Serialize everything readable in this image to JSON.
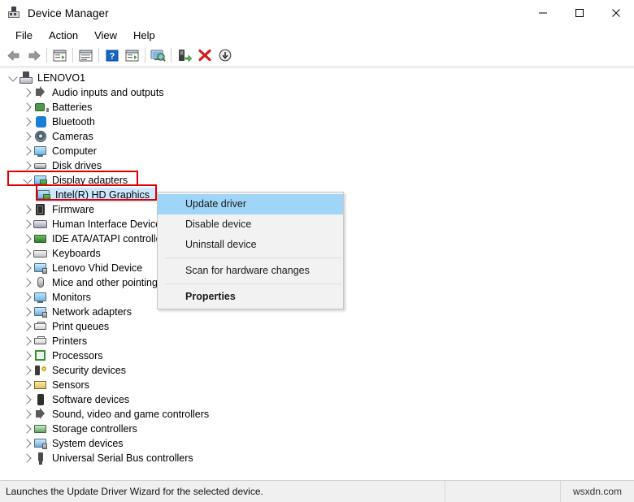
{
  "window": {
    "title": "Device Manager",
    "icon": "device-manager-icon",
    "controls": {
      "minimize": "–",
      "maximize": "□",
      "close": "✕"
    }
  },
  "menubar": {
    "items": [
      {
        "label": "File"
      },
      {
        "label": "Action"
      },
      {
        "label": "View"
      },
      {
        "label": "Help"
      }
    ]
  },
  "toolbar": {
    "buttons": [
      {
        "name": "back-arrow-icon",
        "title": "Back"
      },
      {
        "name": "forward-arrow-icon",
        "title": "Forward"
      },
      {
        "name": "show-hide-console-tree-icon",
        "title": "Show/Hide Console Tree"
      },
      {
        "name": "properties-icon",
        "title": "Properties"
      },
      {
        "name": "help-icon",
        "title": "Help"
      },
      {
        "name": "show-hide-action-pane-icon",
        "title": "Show/Hide Action Pane"
      },
      {
        "name": "scan-hardware-changes-icon",
        "title": "Scan for hardware changes"
      },
      {
        "name": "update-driver-icon",
        "title": "Update Driver Software"
      },
      {
        "name": "uninstall-device-icon",
        "title": "Uninstall device"
      },
      {
        "name": "disable-device-icon",
        "title": "Disable device"
      }
    ]
  },
  "tree": {
    "root": {
      "label": "LENOVO1",
      "icon": "computer-root-icon",
      "expanded": true
    },
    "items": [
      {
        "label": "Audio inputs and outputs",
        "icon": "speaker-icon",
        "expanded": false,
        "level": 2
      },
      {
        "label": "Batteries",
        "icon": "battery-icon",
        "expanded": false,
        "level": 2
      },
      {
        "label": "Bluetooth",
        "icon": "bluetooth-icon",
        "expanded": false,
        "level": 2
      },
      {
        "label": "Cameras",
        "icon": "camera-icon",
        "expanded": false,
        "level": 2
      },
      {
        "label": "Computer",
        "icon": "computer-icon",
        "expanded": false,
        "level": 2
      },
      {
        "label": "Disk drives",
        "icon": "disk-drive-icon",
        "expanded": false,
        "level": 2
      },
      {
        "label": "Display adapters",
        "icon": "display-adapter-icon",
        "expanded": true,
        "level": 2,
        "highlighted": true
      },
      {
        "label": "Intel(R) HD Graphics",
        "icon": "display-adapter-icon",
        "level": 3,
        "selected": true,
        "highlighted": true
      },
      {
        "label": "Firmware",
        "icon": "firmware-icon",
        "expanded": false,
        "level": 2
      },
      {
        "label": "Human Interface Devices",
        "icon": "human-interface-icon",
        "expanded": false,
        "level": 2
      },
      {
        "label": "IDE ATA/ATAPI controllers",
        "icon": "ide-controller-icon",
        "expanded": false,
        "level": 2
      },
      {
        "label": "Keyboards",
        "icon": "keyboard-icon",
        "expanded": false,
        "level": 2
      },
      {
        "label": "Lenovo Vhid Device",
        "icon": "monitor-icon",
        "expanded": false,
        "level": 2
      },
      {
        "label": "Mice and other pointing devices",
        "icon": "mouse-icon",
        "expanded": false,
        "level": 2
      },
      {
        "label": "Monitors",
        "icon": "monitor-icon",
        "expanded": false,
        "level": 2
      },
      {
        "label": "Network adapters",
        "icon": "network-adapter-icon",
        "expanded": false,
        "level": 2
      },
      {
        "label": "Print queues",
        "icon": "printer-icon",
        "expanded": false,
        "level": 2
      },
      {
        "label": "Printers",
        "icon": "printer-icon",
        "expanded": false,
        "level": 2
      },
      {
        "label": "Processors",
        "icon": "processor-icon",
        "expanded": false,
        "level": 2
      },
      {
        "label": "Security devices",
        "icon": "security-device-icon",
        "expanded": false,
        "level": 2
      },
      {
        "label": "Sensors",
        "icon": "sensor-icon",
        "expanded": false,
        "level": 2
      },
      {
        "label": "Software devices",
        "icon": "software-device-icon",
        "expanded": false,
        "level": 2
      },
      {
        "label": "Sound, video and game controllers",
        "icon": "speaker-icon",
        "expanded": false,
        "level": 2
      },
      {
        "label": "Storage controllers",
        "icon": "storage-controller-icon",
        "expanded": false,
        "level": 2
      },
      {
        "label": "System devices",
        "icon": "system-device-icon",
        "expanded": false,
        "level": 2
      },
      {
        "label": "Universal Serial Bus controllers",
        "icon": "usb-controller-icon",
        "expanded": false,
        "level": 2
      }
    ]
  },
  "context_menu": {
    "items": [
      {
        "label": "Update driver",
        "highlighted": true,
        "bold": false
      },
      {
        "label": "Disable device",
        "highlighted": false,
        "bold": false
      },
      {
        "label": "Uninstall device",
        "highlighted": false,
        "bold": false
      },
      {
        "separator": true
      },
      {
        "label": "Scan for hardware changes",
        "highlighted": false,
        "bold": false
      },
      {
        "separator": true
      },
      {
        "label": "Properties",
        "highlighted": false,
        "bold": true
      }
    ]
  },
  "status_bar": {
    "message": "Launches the Update Driver Wizard for the selected device.",
    "middle": "",
    "watermark": "wsxdn.com"
  },
  "colors": {
    "annotation_red": "#e00000",
    "selection_blue": "#cde8ff",
    "menu_highlight_blue": "#9fd5f7",
    "chrome_gray": "#f0f0f0"
  }
}
